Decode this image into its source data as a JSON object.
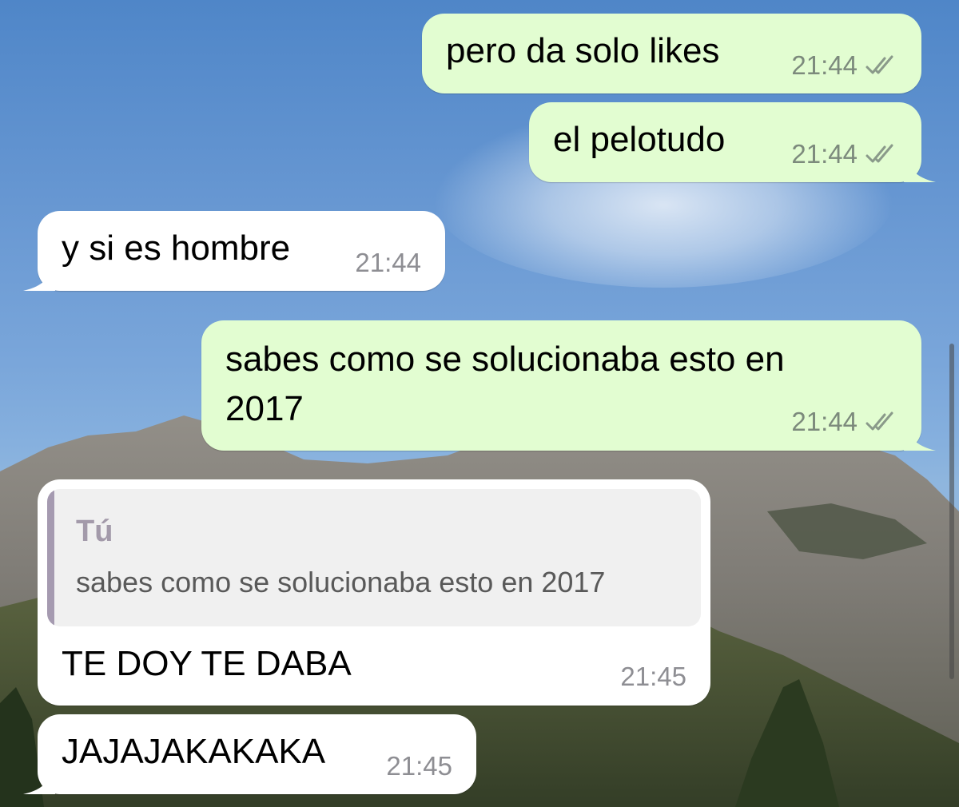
{
  "messages": [
    {
      "text": "pero da solo likes",
      "time": "21:44",
      "direction": "outgoing",
      "status": "read"
    },
    {
      "text": "el pelotudo",
      "time": "21:44",
      "direction": "outgoing",
      "status": "read"
    },
    {
      "text": "y si es hombre",
      "time": "21:44",
      "direction": "incoming"
    },
    {
      "text_line1": "sabes como se solucionaba esto en",
      "text_line2": "2017",
      "time": "21:44",
      "direction": "outgoing",
      "status": "read"
    },
    {
      "quote_author": "Tú",
      "quote_text": "sabes como se solucionaba esto en 2017",
      "text": "TE DOY TE DABA",
      "time": "21:45",
      "direction": "incoming"
    },
    {
      "text": "JAJAJAKAKAKA",
      "time": "21:45",
      "direction": "incoming"
    }
  ],
  "colors": {
    "outgoing_bubble": "#e2fdd1",
    "incoming_bubble": "#ffffff",
    "quote_bar": "#a59ab0",
    "read_ticks": "#8a9a8a"
  },
  "icons": {
    "status": "double-check-icon"
  }
}
